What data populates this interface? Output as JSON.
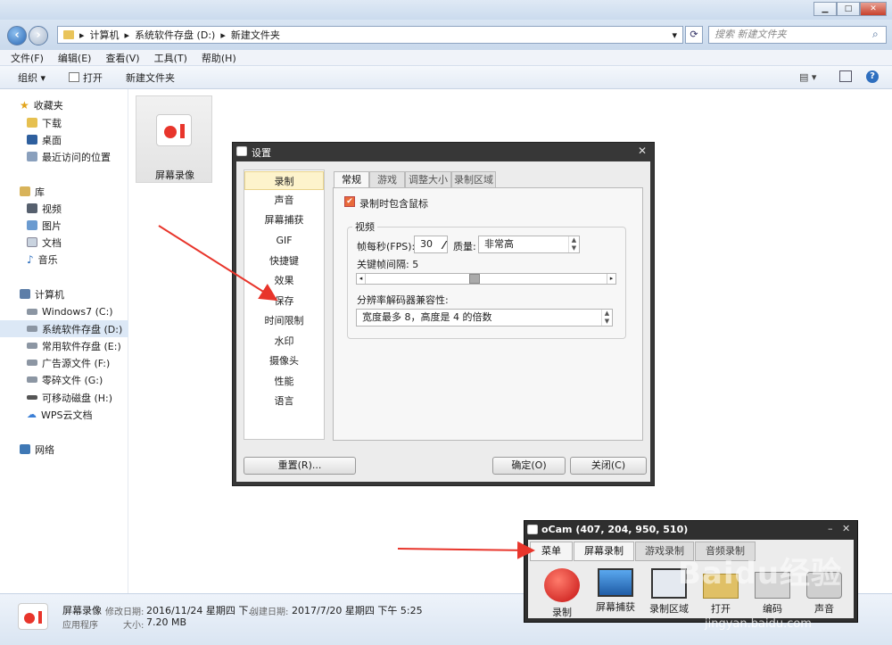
{
  "explorer": {
    "address": {
      "root": "计算机",
      "drive": "系统软件存盘 (D:)",
      "folder": "新建文件夹"
    },
    "search_placeholder": "搜索 新建文件夹",
    "menu": [
      "文件(F)",
      "编辑(E)",
      "查看(V)",
      "工具(T)",
      "帮助(H)"
    ],
    "toolbar": {
      "organize": "组织 ▾",
      "open": "打开",
      "new_folder": "新建文件夹"
    },
    "sidebar": {
      "favorites": "收藏夹",
      "downloads": "下载",
      "desktop": "桌面",
      "recent": "最近访问的位置",
      "library": "库",
      "videos": "视频",
      "pictures": "图片",
      "documents": "文档",
      "music": "音乐",
      "computer": "计算机",
      "drive_c": "Windows7 (C:)",
      "drive_d": "系统软件存盘 (D:)",
      "drive_e": "常用软件存盘 (E:)",
      "drive_f": "广告源文件 (F:)",
      "drive_g": "零碎文件 (G:)",
      "drive_h": "可移动磁盘 (H:)",
      "wps": "WPS云文档",
      "network": "网络"
    },
    "file_name": "屏幕录像",
    "status": {
      "name": "屏幕录像",
      "modified_label": "修改日期:",
      "modified": "2016/11/24 星期四 下...",
      "created_label": "创建日期:",
      "created": "2017/7/20 星期四 下午 5:25",
      "type": "应用程序",
      "size_label": "大小:",
      "size": "7.20 MB"
    }
  },
  "settings": {
    "title": "设置",
    "categories": [
      "录制",
      "声音",
      "屏幕捕获",
      "GIF",
      "快捷键",
      "效果",
      "保存",
      "时间限制",
      "水印",
      "摄像头",
      "性能",
      "语言"
    ],
    "tabs": [
      "常规",
      "游戏",
      "调整大小",
      "录制区域"
    ],
    "include_cursor": "录制时包含鼠标",
    "video_group": "视频",
    "fps_label": "帧每秒(FPS):",
    "fps_value": "30",
    "quality_label": "质量:",
    "quality_value": "非常高",
    "keyframe_label": "关键帧间隔: 5",
    "keyframe_value": 5,
    "codec_label": "分辨率解码器兼容性:",
    "codec_value": "宽度最多 8，高度是 4 的倍数",
    "reset": "重置(R)...",
    "ok": "确定(O)",
    "close": "关闭(C)"
  },
  "ocam": {
    "title": "oCam (407, 204, 950, 510)",
    "tabs": [
      "菜单",
      "屏幕录制",
      "游戏录制",
      "音频录制"
    ],
    "items": [
      "录制",
      "屏幕捕获",
      "录制区域",
      "打开",
      "编码",
      "声音"
    ]
  },
  "watermark": {
    "brand": "Baidu经验",
    "url": "jingyan.baidu.com"
  },
  "colors": {
    "accent": "#e8352b",
    "selection": "#dce8f6",
    "dialog_frame": "#373737"
  }
}
